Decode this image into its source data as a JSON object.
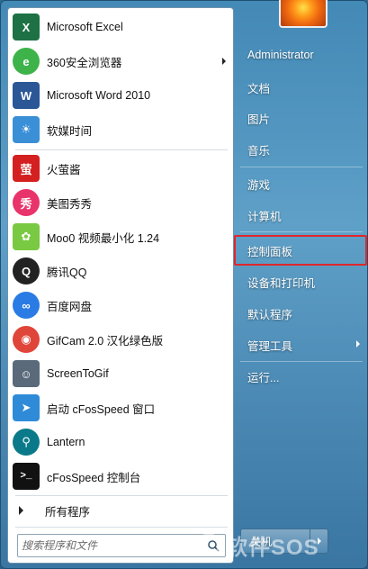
{
  "programs": [
    {
      "label": "Microsoft Excel",
      "icon": "excel-icon",
      "color": "#1e7145",
      "glyph": "X"
    },
    {
      "label": "360安全浏览器",
      "icon": "360-browser-icon",
      "color": "#3db34a",
      "glyph": "e",
      "submenu": true
    },
    {
      "label": "Microsoft Word 2010",
      "icon": "word-icon",
      "color": "#2b5797",
      "glyph": "W"
    },
    {
      "label": "软媒时间",
      "icon": "weather-clock-icon",
      "color": "#3a8fd6",
      "glyph": "☀"
    },
    {
      "label": "火萤酱",
      "icon": "huoying-icon",
      "color": "#d42020",
      "glyph": "萤"
    },
    {
      "label": "美图秀秀",
      "icon": "meitu-icon",
      "color": "#e8336b",
      "glyph": "秀"
    },
    {
      "label": "Moo0 视频最小化 1.24",
      "icon": "moo0-icon",
      "color": "#7ac943",
      "glyph": "✿"
    },
    {
      "label": "腾讯QQ",
      "icon": "qq-icon",
      "color": "#222222",
      "glyph": "Q"
    },
    {
      "label": "百度网盘",
      "icon": "baidu-netdisk-icon",
      "color": "#2a7be4",
      "glyph": "∞"
    },
    {
      "label": "GifCam 2.0 汉化绿色版",
      "icon": "gifcam-icon",
      "color": "#e0453a",
      "glyph": "◉"
    },
    {
      "label": "ScreenToGif",
      "icon": "screentogif-icon",
      "color": "#5a6a7a",
      "glyph": "☺"
    },
    {
      "label": "启动 cFosSpeed 窗口",
      "icon": "cfosspeed-icon",
      "color": "#2f8bd8",
      "glyph": "➤"
    },
    {
      "label": "Lantern",
      "icon": "lantern-icon",
      "color": "#0a7a8a",
      "glyph": "⚲"
    },
    {
      "label": "cFosSpeed 控制台",
      "icon": "console-icon",
      "color": "#111111",
      "glyph": ">_"
    }
  ],
  "all_programs_label": "所有程序",
  "search": {
    "placeholder": "搜索程序和文件"
  },
  "right": {
    "user": "Administrator",
    "items": [
      {
        "label": "文档"
      },
      {
        "label": "图片"
      },
      {
        "label": "音乐"
      },
      {
        "label": "游戏"
      },
      {
        "label": "计算机"
      },
      {
        "label": "控制面板"
      },
      {
        "label": "设备和打印机"
      },
      {
        "label": "默认程序"
      },
      {
        "label": "管理工具"
      },
      {
        "label": "运行..."
      }
    ]
  },
  "shutdown_label": "关机",
  "watermark": "软件SOS",
  "colors": {
    "highlight": "#e0262b",
    "accent": "#3f8ab5"
  }
}
